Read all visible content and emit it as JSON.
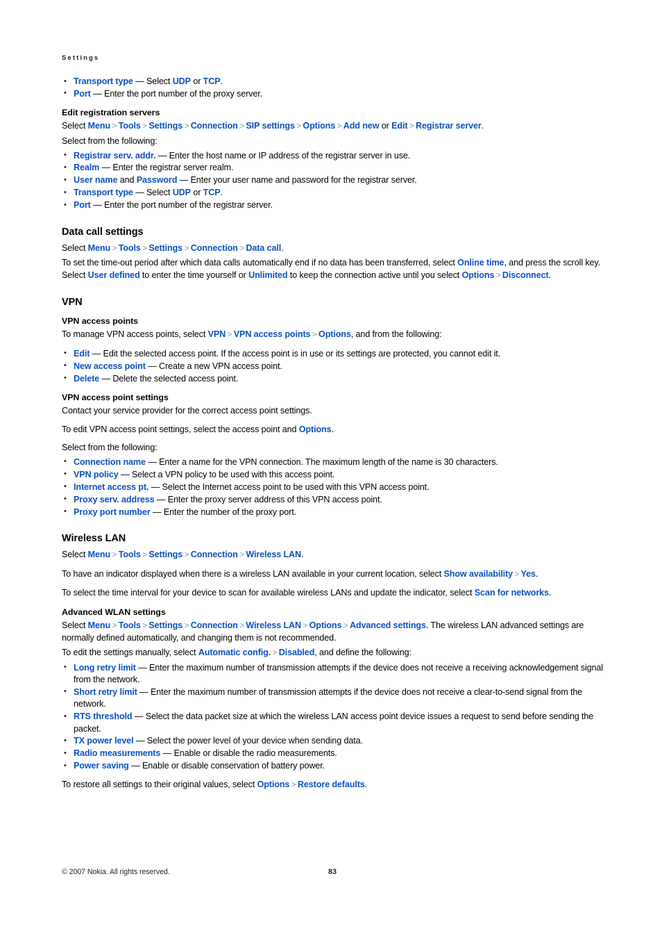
{
  "running_head": "Settings",
  "colors": {
    "link": "#0a52c0",
    "separator": "#7f91ac",
    "text": "#000000"
  },
  "blocks": [
    {
      "kind": "bullets",
      "name": "proxy-server-bullets",
      "items": [
        [
          {
            "t": "link",
            "v": "Transport type"
          },
          {
            "t": "text",
            "v": " — Select "
          },
          {
            "t": "link",
            "v": "UDP"
          },
          {
            "t": "text",
            "v": " or "
          },
          {
            "t": "link",
            "v": "TCP"
          },
          {
            "t": "text",
            "v": "."
          }
        ],
        [
          {
            "t": "link",
            "v": "Port"
          },
          {
            "t": "text",
            "v": " — Enter the port number of the proxy server."
          }
        ]
      ]
    },
    {
      "kind": "h3",
      "name": "heading-edit-registration-servers",
      "text": "Edit registration servers"
    },
    {
      "kind": "para",
      "name": "paragraph-registration-path",
      "tight": true,
      "runs": [
        {
          "t": "text",
          "v": "Select "
        },
        {
          "t": "link",
          "v": "Menu"
        },
        {
          "t": "sep",
          "v": ">"
        },
        {
          "t": "link",
          "v": "Tools"
        },
        {
          "t": "sep",
          "v": ">"
        },
        {
          "t": "link",
          "v": "Settings"
        },
        {
          "t": "sep",
          "v": ">"
        },
        {
          "t": "link",
          "v": "Connection"
        },
        {
          "t": "sep",
          "v": ">"
        },
        {
          "t": "link",
          "v": "SIP settings"
        },
        {
          "t": "sep",
          "v": ">"
        },
        {
          "t": "link",
          "v": "Options"
        },
        {
          "t": "sep",
          "v": ">"
        },
        {
          "t": "link",
          "v": "Add new"
        },
        {
          "t": "text",
          "v": " or "
        },
        {
          "t": "link",
          "v": "Edit"
        },
        {
          "t": "sep",
          "v": ">"
        },
        {
          "t": "link",
          "v": "Registrar server"
        },
        {
          "t": "text",
          "v": "."
        }
      ]
    },
    {
      "kind": "para",
      "name": "paragraph-select-following-1",
      "tight": true,
      "runs": [
        {
          "t": "text",
          "v": "Select from the following:"
        }
      ]
    },
    {
      "kind": "bullets",
      "name": "registrar-server-bullets",
      "items": [
        [
          {
            "t": "link",
            "v": "Registrar serv. addr."
          },
          {
            "t": "text",
            "v": " — Enter the host name or IP address of the registrar server in use."
          }
        ],
        [
          {
            "t": "link",
            "v": "Realm"
          },
          {
            "t": "text",
            "v": " — Enter the registrar server realm."
          }
        ],
        [
          {
            "t": "link",
            "v": "User name"
          },
          {
            "t": "text",
            "v": " and "
          },
          {
            "t": "link",
            "v": "Password"
          },
          {
            "t": "text",
            "v": " — Enter your user name and password for the registrar server."
          }
        ],
        [
          {
            "t": "link",
            "v": "Transport type"
          },
          {
            "t": "text",
            "v": " — Select "
          },
          {
            "t": "link",
            "v": "UDP"
          },
          {
            "t": "text",
            "v": " or "
          },
          {
            "t": "link",
            "v": "TCP"
          },
          {
            "t": "text",
            "v": "."
          }
        ],
        [
          {
            "t": "link",
            "v": "Port"
          },
          {
            "t": "text",
            "v": " — Enter the port number of the registrar server."
          }
        ]
      ]
    },
    {
      "kind": "h2",
      "name": "heading-data-call-settings",
      "text": "Data call settings"
    },
    {
      "kind": "para",
      "name": "paragraph-data-call-path",
      "tight": true,
      "runs": [
        {
          "t": "text",
          "v": "Select "
        },
        {
          "t": "link",
          "v": "Menu"
        },
        {
          "t": "sep",
          "v": ">"
        },
        {
          "t": "link",
          "v": "Tools"
        },
        {
          "t": "sep",
          "v": ">"
        },
        {
          "t": "link",
          "v": "Settings"
        },
        {
          "t": "sep",
          "v": ">"
        },
        {
          "t": "link",
          "v": "Connection"
        },
        {
          "t": "sep",
          "v": ">"
        },
        {
          "t": "link",
          "v": "Data call"
        },
        {
          "t": "text",
          "v": "."
        }
      ]
    },
    {
      "kind": "para",
      "name": "paragraph-online-time",
      "runs": [
        {
          "t": "text",
          "v": "To set the time-out period after which data calls automatically end if no data has been transferred, select "
        },
        {
          "t": "link",
          "v": "Online time"
        },
        {
          "t": "text",
          "v": ", and press the scroll key. Select "
        },
        {
          "t": "link",
          "v": "User defined"
        },
        {
          "t": "text",
          "v": " to enter the time yourself or "
        },
        {
          "t": "link",
          "v": "Unlimited"
        },
        {
          "t": "text",
          "v": " to keep the connection active until you select "
        },
        {
          "t": "link",
          "v": "Options"
        },
        {
          "t": "sep",
          "v": ">"
        },
        {
          "t": "link",
          "v": "Disconnect"
        },
        {
          "t": "text",
          "v": "."
        }
      ]
    },
    {
      "kind": "h2",
      "name": "heading-vpn",
      "text": "VPN"
    },
    {
      "kind": "h3",
      "name": "heading-vpn-access-points",
      "text": "VPN access points"
    },
    {
      "kind": "para",
      "name": "paragraph-manage-vpn-access-points",
      "runs": [
        {
          "t": "text",
          "v": "To manage VPN access points, select "
        },
        {
          "t": "link",
          "v": "VPN"
        },
        {
          "t": "sep",
          "v": ">"
        },
        {
          "t": "link",
          "v": "VPN access points"
        },
        {
          "t": "sep",
          "v": ">"
        },
        {
          "t": "link",
          "v": "Options"
        },
        {
          "t": "text",
          "v": ", and from the following:"
        }
      ]
    },
    {
      "kind": "bullets",
      "name": "vpn-access-point-option-bullets",
      "items": [
        [
          {
            "t": "link",
            "v": "Edit"
          },
          {
            "t": "text",
            "v": " — Edit the selected access point. If the access point is in use or its settings are protected, you cannot edit it."
          }
        ],
        [
          {
            "t": "link",
            "v": "New access point"
          },
          {
            "t": "text",
            "v": " — Create a new VPN access point."
          }
        ],
        [
          {
            "t": "link",
            "v": "Delete"
          },
          {
            "t": "text",
            "v": " — Delete the selected access point."
          }
        ]
      ]
    },
    {
      "kind": "h3",
      "name": "heading-vpn-access-point-settings",
      "text": "VPN access point settings"
    },
    {
      "kind": "para",
      "name": "paragraph-contact-service-provider",
      "runs": [
        {
          "t": "text",
          "v": "Contact your service provider for the correct access point settings."
        }
      ]
    },
    {
      "kind": "para",
      "name": "paragraph-edit-vpn-access-point-settings",
      "runs": [
        {
          "t": "text",
          "v": "To edit VPN access point settings, select the access point and "
        },
        {
          "t": "link",
          "v": "Options"
        },
        {
          "t": "text",
          "v": "."
        }
      ]
    },
    {
      "kind": "para",
      "name": "paragraph-select-following-2",
      "tight": true,
      "runs": [
        {
          "t": "text",
          "v": "Select from the following:"
        }
      ]
    },
    {
      "kind": "bullets",
      "name": "vpn-access-point-settings-bullets",
      "items": [
        [
          {
            "t": "link",
            "v": "Connection name"
          },
          {
            "t": "text",
            "v": " — Enter a name for the VPN connection. The maximum length of the name is 30 characters."
          }
        ],
        [
          {
            "t": "link",
            "v": "VPN policy"
          },
          {
            "t": "text",
            "v": " — Select a VPN policy to be used with this access point."
          }
        ],
        [
          {
            "t": "link",
            "v": "Internet access pt."
          },
          {
            "t": "text",
            "v": " — Select the Internet access point to be used with this VPN access point."
          }
        ],
        [
          {
            "t": "link",
            "v": "Proxy serv. address"
          },
          {
            "t": "text",
            "v": " — Enter the proxy server address of this VPN access point."
          }
        ],
        [
          {
            "t": "link",
            "v": "Proxy port number"
          },
          {
            "t": "text",
            "v": " — Enter the number of the proxy port."
          }
        ]
      ]
    },
    {
      "kind": "h2",
      "name": "heading-wireless-lan",
      "text": "Wireless LAN"
    },
    {
      "kind": "para",
      "name": "paragraph-wireless-lan-path",
      "runs": [
        {
          "t": "text",
          "v": "Select "
        },
        {
          "t": "link",
          "v": "Menu"
        },
        {
          "t": "sep",
          "v": ">"
        },
        {
          "t": "link",
          "v": "Tools"
        },
        {
          "t": "sep",
          "v": ">"
        },
        {
          "t": "link",
          "v": "Settings"
        },
        {
          "t": "sep",
          "v": ">"
        },
        {
          "t": "link",
          "v": "Connection"
        },
        {
          "t": "sep",
          "v": ">"
        },
        {
          "t": "link",
          "v": "Wireless LAN"
        },
        {
          "t": "text",
          "v": "."
        }
      ]
    },
    {
      "kind": "para",
      "name": "paragraph-show-availability",
      "runs": [
        {
          "t": "text",
          "v": "To have an indicator displayed when there is a wireless LAN available in your current location, select "
        },
        {
          "t": "link",
          "v": "Show availability"
        },
        {
          "t": "sep",
          "v": ">"
        },
        {
          "t": "link",
          "v": "Yes"
        },
        {
          "t": "text",
          "v": "."
        }
      ]
    },
    {
      "kind": "para",
      "name": "paragraph-scan-for-networks",
      "runs": [
        {
          "t": "text",
          "v": "To select the time interval for your device to scan for available wireless LANs and update the indicator, select "
        },
        {
          "t": "link",
          "v": "Scan for networks"
        },
        {
          "t": "text",
          "v": "."
        }
      ]
    },
    {
      "kind": "h3",
      "name": "heading-advanced-wlan-settings",
      "text": "Advanced WLAN settings"
    },
    {
      "kind": "para",
      "name": "paragraph-advanced-settings-path",
      "tight": true,
      "runs": [
        {
          "t": "text",
          "v": "Select "
        },
        {
          "t": "link",
          "v": "Menu"
        },
        {
          "t": "sep",
          "v": ">"
        },
        {
          "t": "link",
          "v": "Tools"
        },
        {
          "t": "sep",
          "v": ">"
        },
        {
          "t": "link",
          "v": "Settings"
        },
        {
          "t": "sep",
          "v": ">"
        },
        {
          "t": "link",
          "v": "Connection"
        },
        {
          "t": "sep",
          "v": ">"
        },
        {
          "t": "link",
          "v": "Wireless LAN"
        },
        {
          "t": "sep",
          "v": ">"
        },
        {
          "t": "link",
          "v": "Options"
        },
        {
          "t": "sep",
          "v": ">"
        },
        {
          "t": "link",
          "v": "Advanced settings"
        },
        {
          "t": "text",
          "v": ". The wireless LAN advanced settings are normally defined automatically, and changing them is not recommended."
        }
      ]
    },
    {
      "kind": "para",
      "name": "paragraph-automatic-config",
      "tight": true,
      "runs": [
        {
          "t": "text",
          "v": "To edit the settings manually, select "
        },
        {
          "t": "link",
          "v": "Automatic config."
        },
        {
          "t": "sep",
          "v": ">"
        },
        {
          "t": "link",
          "v": "Disabled"
        },
        {
          "t": "text",
          "v": ", and define the following:"
        }
      ]
    },
    {
      "kind": "bullets",
      "name": "advanced-wlan-settings-bullets",
      "items": [
        [
          {
            "t": "link",
            "v": "Long retry limit"
          },
          {
            "t": "text",
            "v": " — Enter the maximum number of transmission attempts if the device does not receive a receiving acknowledgement signal from the network."
          }
        ],
        [
          {
            "t": "link",
            "v": "Short retry limit"
          },
          {
            "t": "text",
            "v": " — Enter the maximum number of transmission attempts if the device does not receive a clear-to-send signal from the network."
          }
        ],
        [
          {
            "t": "link",
            "v": "RTS threshold"
          },
          {
            "t": "text",
            "v": " — Select the data packet size at which the wireless LAN access point device issues a request to send before sending the packet."
          }
        ],
        [
          {
            "t": "link",
            "v": "TX power level"
          },
          {
            "t": "text",
            "v": " — Select the power level of your device when sending data."
          }
        ],
        [
          {
            "t": "link",
            "v": "Radio measurements"
          },
          {
            "t": "text",
            "v": " — Enable or disable the radio measurements."
          }
        ],
        [
          {
            "t": "link",
            "v": "Power saving"
          },
          {
            "t": "text",
            "v": " — Enable or disable conservation of battery power."
          }
        ]
      ]
    },
    {
      "kind": "para",
      "name": "paragraph-restore-defaults",
      "runs": [
        {
          "t": "text",
          "v": "To restore all settings to their original values, select "
        },
        {
          "t": "link",
          "v": "Options"
        },
        {
          "t": "sep",
          "v": ">"
        },
        {
          "t": "link",
          "v": "Restore defaults"
        },
        {
          "t": "text",
          "v": "."
        }
      ]
    }
  ],
  "footer": {
    "copyright": "© 2007 Nokia. All rights reserved.",
    "page_number": "83"
  }
}
